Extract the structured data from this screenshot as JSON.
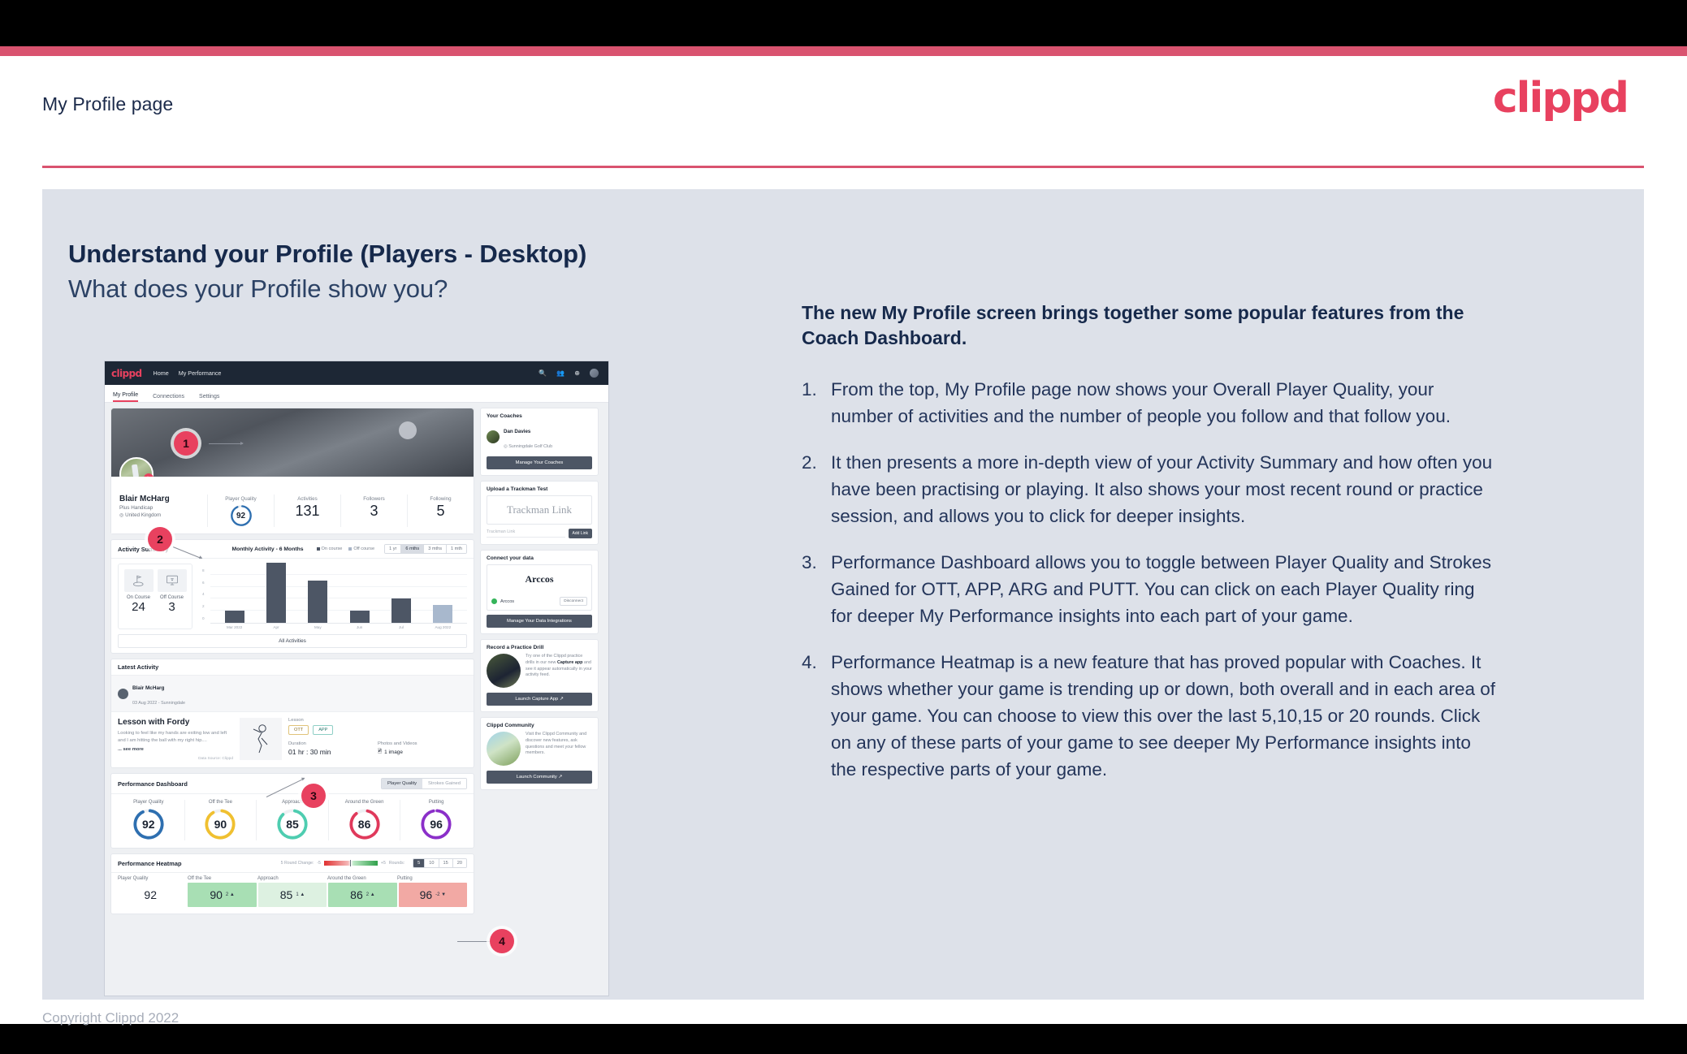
{
  "header": {
    "title": "My Profile page",
    "logo": "clippd"
  },
  "slide": {
    "heading_main": "Understand your Profile (Players - Desktop)",
    "heading_sub": "What does your Profile show you?",
    "footer": "Copyright Clippd 2022"
  },
  "copy": {
    "lead": "The new My Profile screen brings together some popular features from the Coach Dashboard.",
    "items": [
      {
        "num": "1.",
        "text": "From the top, My Profile page now shows your Overall Player Quality, your number of activities and the number of people you follow and that follow you."
      },
      {
        "num": "2.",
        "text": "It then presents a more in-depth view of your Activity Summary and how often you have been practising or playing. It also shows your most recent round or practice session, and allows you to click for deeper insights."
      },
      {
        "num": "3.",
        "text": "Performance Dashboard allows you to toggle between Player Quality and Strokes Gained for OTT, APP, ARG and PUTT. You can click on each Player Quality ring for deeper My Performance insights into each part of your game."
      },
      {
        "num": "4.",
        "text": "Performance Heatmap is a new feature that has proved popular with Coaches. It shows whether your game is trending up or down, both overall and in each area of your game. You can choose to view this over the last 5,10,15 or 20 rounds. Click on any of these parts of your game to see deeper My Performance insights into the respective parts of your game."
      }
    ]
  },
  "markers": [
    "1",
    "2",
    "3",
    "4"
  ],
  "app": {
    "logo": "clippd",
    "nav": [
      "Home",
      "My Performance"
    ],
    "nav_icons": [
      "search-icon",
      "people-icon",
      "add-circle-icon",
      "avatar-icon"
    ],
    "tabs": [
      {
        "label": "My Profile",
        "active": true
      },
      {
        "label": "Connections",
        "active": false
      },
      {
        "label": "Settings",
        "active": false
      }
    ],
    "profile": {
      "name": "Blair McHarg",
      "handicap": "Plus Handicap",
      "location": "United Kingdom",
      "stats": [
        {
          "label": "Player Quality",
          "value": "92",
          "ring": true,
          "color": "#2e6fb0"
        },
        {
          "label": "Activities",
          "value": "131"
        },
        {
          "label": "Followers",
          "value": "3"
        },
        {
          "label": "Following",
          "value": "5"
        }
      ]
    },
    "activity_summary": {
      "title": "Activity Summary",
      "chart_title": "Monthly Activity - 6 Months",
      "legend": [
        "On course",
        "Off course"
      ],
      "ranges": [
        "1 yr",
        "6 mths",
        "3 mths",
        "1 mth"
      ],
      "active_range": "6 mths",
      "tiles": [
        {
          "label": "On Course",
          "value": "24",
          "icon": "golf-flag-icon"
        },
        {
          "label": "Off Course",
          "value": "3",
          "icon": "monitor-icon"
        }
      ],
      "all_activities": "All Activities"
    },
    "latest_activity": {
      "section_title": "Latest Activity",
      "user": "Blair McHarg",
      "date": "03 Aug 2022 - Sunningdale",
      "title": "Lesson with Fordy",
      "description": "Looking to feel like my hands are exiting low and left and I am hitting the ball with my right hip....",
      "see_more": "... see more",
      "source": "Data Source: Clippd",
      "type_label": "Lesson",
      "tags": [
        "OTT",
        "APP"
      ],
      "duration_label": "Duration",
      "duration_value": "01 hr : 30 min",
      "media_label": "Photos and Videos",
      "media_value": "1 image"
    },
    "performance_dashboard": {
      "title": "Performance Dashboard",
      "toggle": [
        "Player Quality",
        "Strokes Gained"
      ],
      "toggle_active": "Player Quality",
      "rings": [
        {
          "label": "Player Quality",
          "value": "92",
          "color": "#2e6fb0"
        },
        {
          "label": "Off the Tee",
          "value": "90",
          "color": "#f0c030"
        },
        {
          "label": "Approach",
          "value": "85",
          "color": "#4ecdb0"
        },
        {
          "label": "Around the Green",
          "value": "86",
          "color": "#e0395b"
        },
        {
          "label": "Putting",
          "value": "96",
          "color": "#8b2fc9"
        }
      ]
    },
    "performance_heatmap": {
      "title": "Performance Heatmap",
      "change_label": "5 Round Change:",
      "scale_min": "-5",
      "scale_max": "+5",
      "rounds_label": "Rounds:",
      "rounds": [
        "5",
        "10",
        "15",
        "20"
      ],
      "rounds_active": "5",
      "cells": [
        {
          "label": "Player Quality",
          "value": "92",
          "delta": "",
          "bg": "#ffffff"
        },
        {
          "label": "Off the Tee",
          "value": "90",
          "delta": "2 ▲",
          "bg": "#a8dfb4"
        },
        {
          "label": "Approach",
          "value": "85",
          "delta": "1 ▲",
          "bg": "#ddf1e1"
        },
        {
          "label": "Around the Green",
          "value": "86",
          "delta": "2 ▲",
          "bg": "#a8dfb4"
        },
        {
          "label": "Putting",
          "value": "96",
          "delta": "-2 ▼",
          "bg": "#f2a9a4"
        }
      ]
    },
    "sidebar": {
      "coaches": {
        "title": "Your Coaches",
        "name": "Dan Davies",
        "club": "Sunningdale Golf Club",
        "button": "Manage Your Coaches"
      },
      "trackman": {
        "title": "Upload a Trackman Test",
        "box_text": "Trackman Link",
        "input_placeholder": "Trackman Link",
        "button": "Add Link"
      },
      "connect": {
        "title": "Connect your data",
        "brand": "Arccos",
        "status_name": "Arccos",
        "status_button": "Disconnect",
        "button": "Manage Your Data Integrations"
      },
      "drill": {
        "title": "Record a Practice Drill",
        "text_a": "Try one of the Clippd practice drills in our new ",
        "text_b": "Capture app",
        "text_c": " and see it appear automatically in your activity feed.",
        "button": "Launch Capture App"
      },
      "community": {
        "title": "Clippd Community",
        "text": "Visit the Clippd Community and discover new features, ask questions and meet your fellow members.",
        "button": "Launch Community"
      }
    }
  },
  "chart_data": {
    "type": "bar",
    "title": "Monthly Activity - 6 Months",
    "categories": [
      "Mar 2022",
      "Apr",
      "May",
      "Jun",
      "Jul",
      "Aug 2022"
    ],
    "values": [
      2,
      10,
      7,
      2,
      4,
      3
    ],
    "series": [
      {
        "name": "On course",
        "values": [
          2,
          10,
          7,
          2,
          4,
          null
        ]
      },
      {
        "name": "Off course",
        "values": [
          null,
          null,
          null,
          null,
          null,
          3
        ]
      }
    ],
    "ylabel": "",
    "xlabel": "",
    "ylim": [
      0,
      10
    ],
    "yticks": [
      0,
      2,
      4,
      6,
      8
    ],
    "grid": true,
    "legend": "top"
  }
}
